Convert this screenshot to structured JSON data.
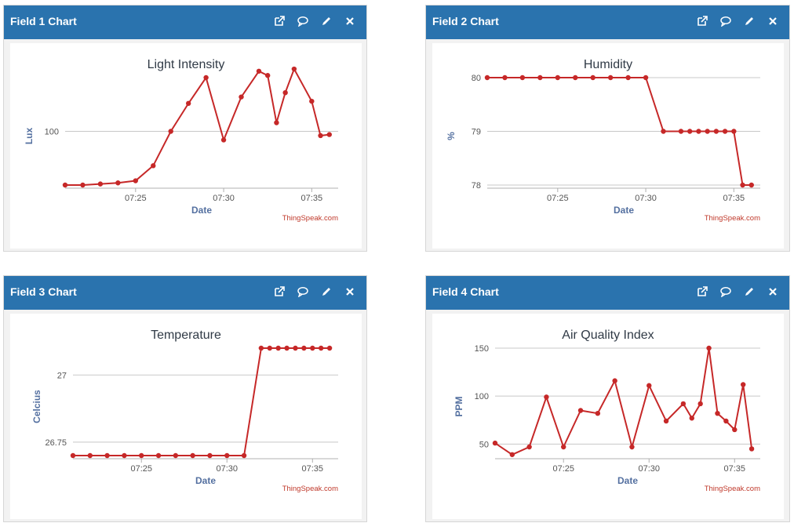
{
  "colors": {
    "header": "#2a73ae",
    "series": "#c62828",
    "credit": "#c0392b"
  },
  "toolbar_icons": [
    "external-link-icon",
    "comment-icon",
    "pencil-icon",
    "close-icon"
  ],
  "credit": "ThingSpeak.com",
  "panels": [
    {
      "title": "Field 1 Chart",
      "chart_data": {
        "type": "line",
        "title": "Light Intensity",
        "xlabel": "Date",
        "ylabel": "Lux",
        "x_range": [
          "07:21",
          "07:36.5"
        ],
        "x_ticks": [
          "07:25",
          "07:30",
          "07:35"
        ],
        "y_ticks": [
          100
        ],
        "ylim": [
          75,
          125
        ],
        "series": [
          {
            "x": [
              "07:21",
              "07:22",
              "07:23",
              "07:24",
              "07:25",
              "07:26",
              "07:27",
              "07:28",
              "07:29",
              "07:30",
              "07:31",
              "07:32",
              "07:32.5",
              "07:33",
              "07:33.5",
              "07:34",
              "07:35",
              "07:35.5",
              "07:36"
            ],
            "values": [
              75,
              75,
              75.5,
              76,
              77,
              84,
              100,
              113,
              125,
              96,
              116,
              128,
              126,
              104,
              118,
              129,
              114,
              98,
              98.5,
              100
            ]
          }
        ]
      }
    },
    {
      "title": "Field 2 Chart",
      "chart_data": {
        "type": "line",
        "title": "Humidity",
        "xlabel": "Date",
        "ylabel": "%",
        "x_range": [
          "07:21",
          "07:36.5"
        ],
        "x_ticks": [
          "07:25",
          "07:30",
          "07:35"
        ],
        "y_ticks": [
          78,
          79,
          80
        ],
        "ylim": [
          78,
          80
        ],
        "series": [
          {
            "x": [
              "07:21",
              "07:22",
              "07:23",
              "07:24",
              "07:25",
              "07:26",
              "07:27",
              "07:28",
              "07:29",
              "07:30",
              "07:31",
              "07:32",
              "07:32.5",
              "07:33",
              "07:33.5",
              "07:34",
              "07:34.5",
              "07:35",
              "07:35.5",
              "07:36"
            ],
            "values": [
              80,
              80,
              80,
              80,
              80,
              80,
              80,
              80,
              80,
              80,
              79,
              79,
              79,
              79,
              79,
              79,
              79,
              79,
              78,
              78
            ]
          }
        ]
      }
    },
    {
      "title": "Field 3 Chart",
      "chart_data": {
        "type": "line",
        "title": "Temperature",
        "xlabel": "Date",
        "ylabel": "Celcius",
        "x_range": [
          "07:21",
          "07:36.5"
        ],
        "x_ticks": [
          "07:25",
          "07:30",
          "07:35"
        ],
        "y_ticks": [
          26.75,
          27
        ],
        "ylim": [
          26.7,
          27.1
        ],
        "series": [
          {
            "x": [
              "07:21",
              "07:22",
              "07:23",
              "07:24",
              "07:25",
              "07:26",
              "07:27",
              "07:28",
              "07:29",
              "07:30",
              "07:31",
              "07:32",
              "07:32.5",
              "07:33",
              "07:33.5",
              "07:34",
              "07:34.5",
              "07:35",
              "07:35.5",
              "07:36"
            ],
            "values": [
              26.7,
              26.7,
              26.7,
              26.7,
              26.7,
              26.7,
              26.7,
              26.7,
              26.7,
              26.7,
              26.7,
              27.1,
              27.1,
              27.1,
              27.1,
              27.1,
              27.1,
              27.1,
              27.1,
              27.1
            ]
          }
        ]
      }
    },
    {
      "title": "Field 4 Chart",
      "chart_data": {
        "type": "line",
        "title": "Air Quality Index",
        "xlabel": "Date",
        "ylabel": "PPM",
        "x_range": [
          "07:21",
          "07:36.5"
        ],
        "x_ticks": [
          "07:25",
          "07:30",
          "07:35"
        ],
        "y_ticks": [
          50,
          100,
          150
        ],
        "ylim": [
          38,
          150
        ],
        "series": [
          {
            "x": [
              "07:21",
              "07:22",
              "07:23",
              "07:24",
              "07:25",
              "07:26",
              "07:27",
              "07:28",
              "07:29",
              "07:30",
              "07:31",
              "07:32",
              "07:32.5",
              "07:33",
              "07:33.5",
              "07:34",
              "07:34.5",
              "07:35",
              "07:35.5",
              "07:36"
            ],
            "values": [
              51,
              39,
              47,
              99,
              47,
              85,
              82,
              116,
              47,
              111,
              74,
              92,
              77,
              92,
              150,
              82,
              74,
              65,
              112,
              45
            ]
          }
        ]
      }
    }
  ]
}
